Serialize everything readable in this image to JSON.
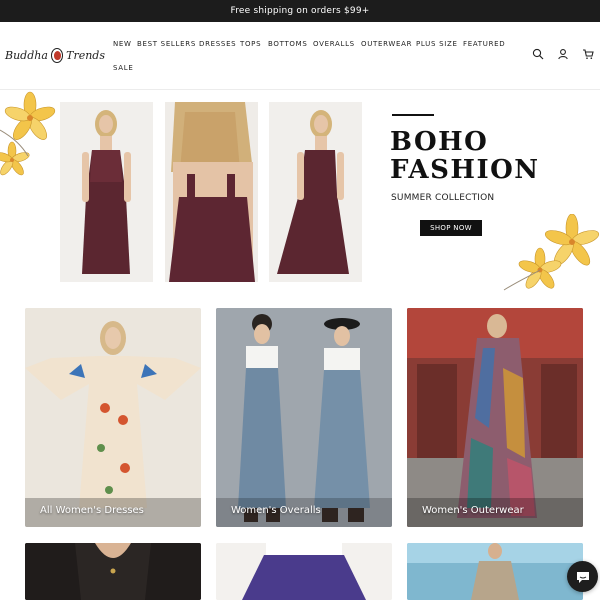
{
  "announcement": {
    "text": "Free shipping on orders $99+"
  },
  "brand": {
    "word1": "Buddha",
    "word2": "Trends"
  },
  "nav": {
    "items": [
      "NEW",
      "BEST SELLERS",
      "DRESSES",
      "TOPS",
      "BOTTOMS",
      "OVERALLS",
      "OUTERWEAR",
      "PLUS SIZE",
      "FEATURED",
      "SALE"
    ]
  },
  "header_icons": [
    "search-icon",
    "account-icon",
    "cart-icon"
  ],
  "hero": {
    "title": "BOHO\nFASHION",
    "subtitle": "SUMMER COLLECTION",
    "cta": "SHOP NOW"
  },
  "collections": [
    {
      "label": "All Women's Dresses"
    },
    {
      "label": "Women's Overalls"
    },
    {
      "label": "Women's Outerwear"
    }
  ],
  "colors": {
    "announcement_bg": "#1c1c1c",
    "accent": "#111111",
    "flower": "#f1c34d"
  },
  "chat": {
    "icon": "chat-icon"
  }
}
